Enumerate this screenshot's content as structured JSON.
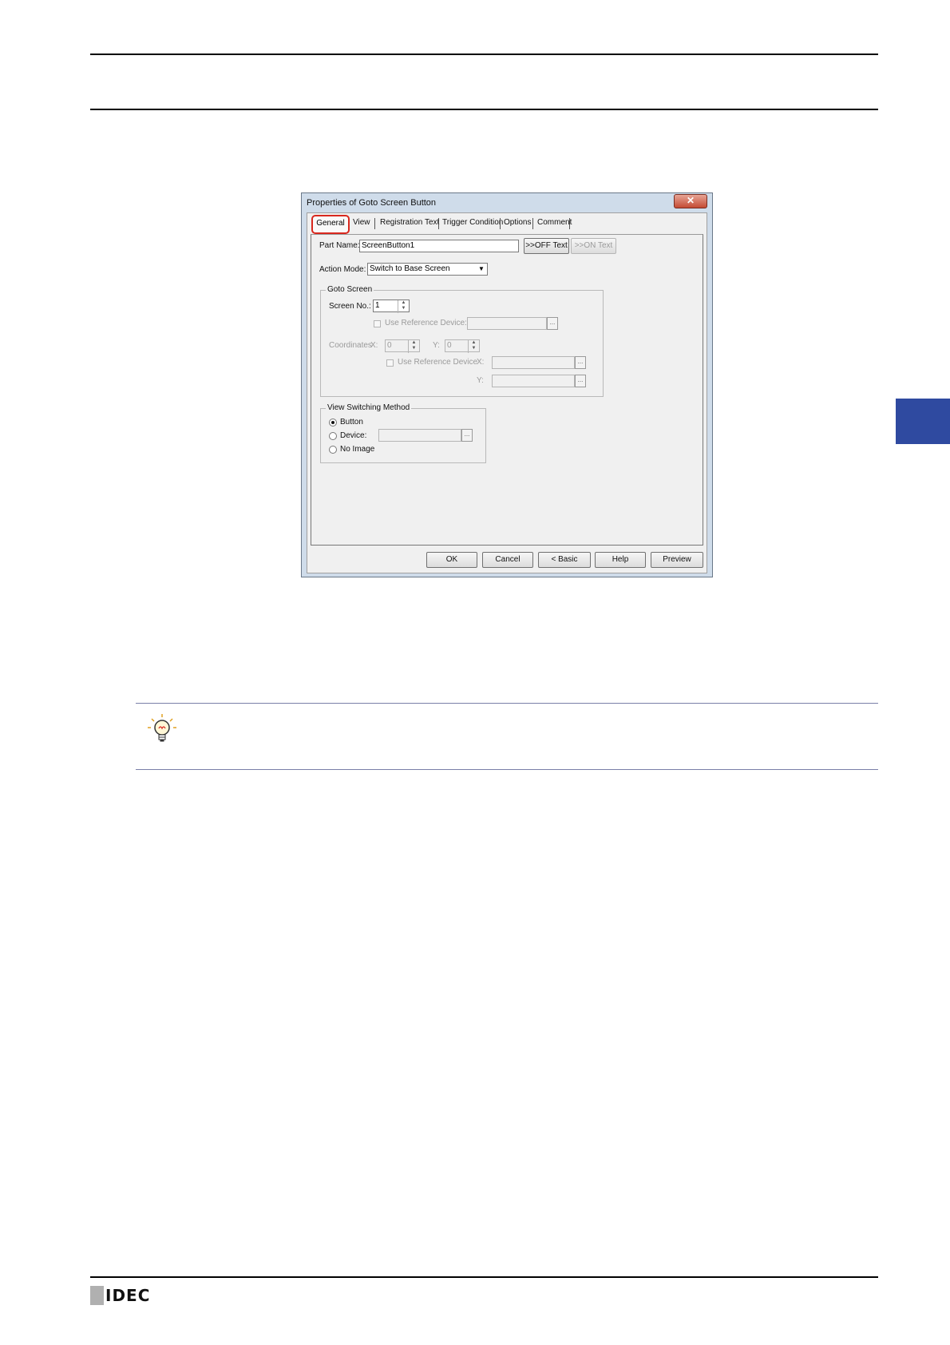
{
  "dialog": {
    "title": "Properties of Goto Screen Button",
    "close_glyph": "✕",
    "tabs": [
      "General",
      "View",
      "Registration Text",
      "Trigger Condition",
      "Options",
      "Comment"
    ],
    "part_name_label": "Part Name:",
    "part_name_value": "ScreenButton1",
    "off_text_button": ">>OFF Text",
    "on_text_button": ">>ON Text",
    "action_mode_label": "Action Mode:",
    "action_mode_value": "Switch to Base Screen",
    "goto_screen": {
      "title": "Goto Screen",
      "screen_no_label": "Screen No.:",
      "screen_no_value": "1",
      "use_ref_device_label": "Use Reference Device:",
      "coordinates_label": "Coordinates",
      "x_label": "X:",
      "x_value": "0",
      "y_label": "Y:",
      "y_value": "0",
      "use_ref_device_label2": "Use Reference Device",
      "ref_x_label": "X:",
      "ref_y_label": "Y:"
    },
    "view_switching": {
      "title": "View Switching Method",
      "options": [
        "Button",
        "Device:",
        "No Image"
      ],
      "selected": "Button"
    },
    "buttons": {
      "ok": "OK",
      "cancel": "Cancel",
      "basic": "< Basic",
      "help": "Help",
      "preview": "Preview"
    }
  },
  "footer": {
    "logo_text": "IDEC"
  }
}
